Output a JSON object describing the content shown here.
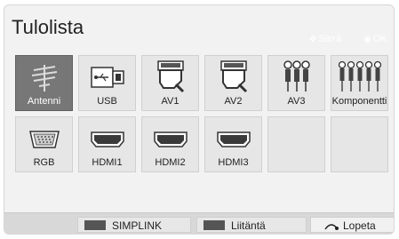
{
  "title": "Tulolista",
  "hints": {
    "move": "Siirrä",
    "ok": "OK"
  },
  "inputs": [
    {
      "label": "Antenni",
      "icon": "antenna-icon",
      "selected": true
    },
    {
      "label": "USB",
      "icon": "usb-icon",
      "selected": false
    },
    {
      "label": "AV1",
      "icon": "scart-icon",
      "selected": false
    },
    {
      "label": "AV2",
      "icon": "scart-icon",
      "selected": false
    },
    {
      "label": "AV3",
      "icon": "rca-icon",
      "selected": false
    },
    {
      "label": "Komponentti",
      "icon": "component-rca-icon",
      "selected": false
    },
    {
      "label": "RGB",
      "icon": "vga-port-icon",
      "selected": false
    },
    {
      "label": "HDMI1",
      "icon": "hdmi-port-icon",
      "selected": false
    },
    {
      "label": "HDMI2",
      "icon": "hdmi-port-icon",
      "selected": false
    },
    {
      "label": "HDMI3",
      "icon": "hdmi-port-icon",
      "selected": false
    }
  ],
  "bottom": {
    "simplink": "SIMPLINK",
    "liitanta": "Liitäntä",
    "lopeta": "Lopeta"
  }
}
